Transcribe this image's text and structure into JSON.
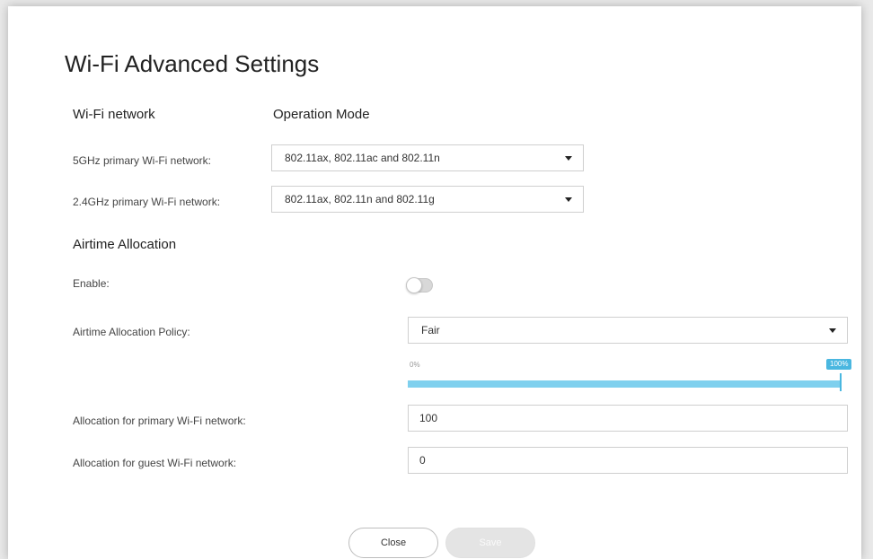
{
  "title": "Wi-Fi Advanced Settings",
  "columns": {
    "network": "Wi-Fi network",
    "mode": "Operation Mode"
  },
  "networks": [
    {
      "label": "5GHz primary Wi-Fi network:",
      "mode": "802.11ax, 802.11ac and 802.11n"
    },
    {
      "label": "2.4GHz primary Wi-Fi network:",
      "mode": "802.11ax, 802.11n and 802.11g"
    }
  ],
  "airtime": {
    "heading": "Airtime Allocation",
    "enable_label": "Enable:",
    "enabled": false,
    "policy_label": "Airtime Allocation Policy:",
    "policy_value": "Fair",
    "slider_min": "0%",
    "slider_max": "100%",
    "slider_value_percent": 100,
    "primary_label": "Allocation for primary Wi-Fi network:",
    "primary_value": "100",
    "guest_label": "Allocation for guest Wi-Fi network:",
    "guest_value": "0"
  },
  "buttons": {
    "close": "Close",
    "save": "Save"
  },
  "colors": {
    "accent": "#4ab7e0",
    "slider_fill": "#7fd0ee"
  }
}
